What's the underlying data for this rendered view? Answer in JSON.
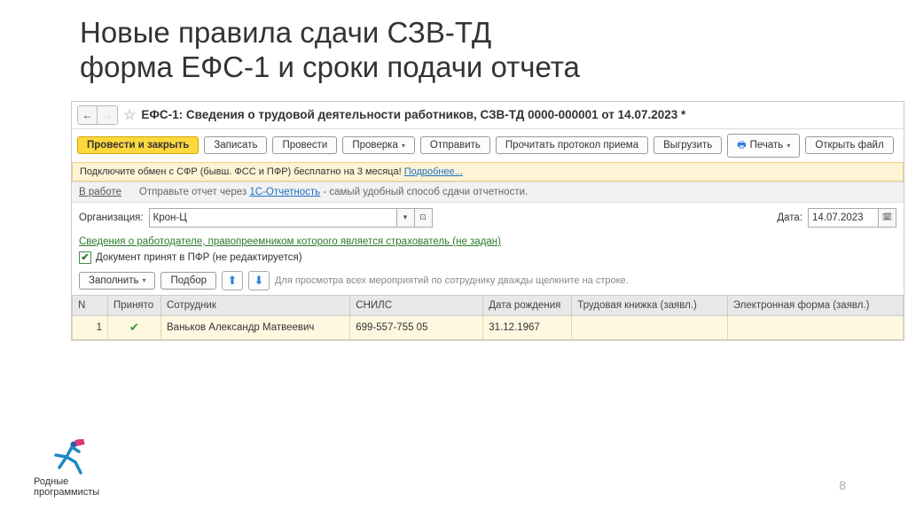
{
  "slide": {
    "title_line1": "Новые правила сдачи СЗВ-ТД",
    "title_line2": "форма ЕФС-1 и сроки подачи отчета",
    "page_number": "8",
    "logo_line1": "Родные",
    "logo_line2": "программисты"
  },
  "titlebar": {
    "doc_title": "ЕФС-1: Сведения о трудовой деятельности работников, СЗВ-ТД 0000-000001 от 14.07.2023 *"
  },
  "toolbar": {
    "post_and_close": "Провести и закрыть",
    "write": "Записать",
    "post": "Провести",
    "check": "Проверка",
    "send": "Отправить",
    "read_protocol": "Прочитать протокол приема",
    "export": "Выгрузить",
    "print": "Печать",
    "open_file": "Открыть файл"
  },
  "info_bar": {
    "text": "Подключите обмен с СФР (бывш. ФСС и ПФР) бесплатно на 3 месяца! ",
    "link": "Подробнее..."
  },
  "status_bar": {
    "status": "В работе",
    "hint_prefix": "Отправьте отчет через ",
    "hint_link": "1С-Отчетность",
    "hint_suffix": " - самый удобный способ сдачи отчетности."
  },
  "form": {
    "org_label": "Организация:",
    "org_value": "Крон-Ц",
    "date_label": "Дата:",
    "date_value": "14.07.2023",
    "employer_link": "Сведения о работодателе, правопреемником которого является страхователь (не задан)",
    "accepted_chk_label": "Документ принят в ПФР (не редактируется)"
  },
  "sub_toolbar": {
    "fill": "Заполнить",
    "pick": "Подбор",
    "hint": "Для просмотра всех мероприятий по сотруднику дважды щелкните на строке."
  },
  "table": {
    "headers": {
      "n": "N",
      "accepted": "Принято",
      "employee": "Сотрудник",
      "snils": "СНИЛС",
      "dob": "Дата рождения",
      "workbook": "Трудовая книжка (заявл.)",
      "electronic": "Электронная форма (заявл.)"
    },
    "row1": {
      "n": "1",
      "employee": "Ваньков Александр Матвеевич",
      "snils": "699-557-755 05",
      "dob": "31.12.1967"
    }
  }
}
